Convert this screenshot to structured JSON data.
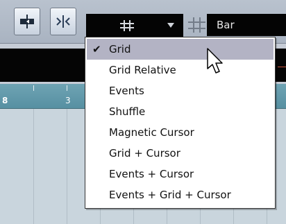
{
  "toolbar": {
    "snap_dropdown_icon": "grid-icon",
    "grid_type_icon": "grid-icon",
    "quantize_value": "Bar"
  },
  "ruler": {
    "labels": [
      "8",
      "3"
    ]
  },
  "snap_menu": {
    "selected": "Grid",
    "items": [
      {
        "label": "Grid",
        "checked": true,
        "highlighted": true
      },
      {
        "label": "Grid Relative"
      },
      {
        "label": "Events"
      },
      {
        "label": "Shuffle"
      },
      {
        "label": "Magnetic Cursor"
      },
      {
        "label": "Grid + Cursor"
      },
      {
        "label": "Events + Cursor"
      },
      {
        "label": "Events + Grid + Cursor"
      }
    ]
  },
  "colors": {
    "highlight": "#b3b3c4",
    "ruler": "#6ea3b3",
    "field_bg": "#040404"
  }
}
